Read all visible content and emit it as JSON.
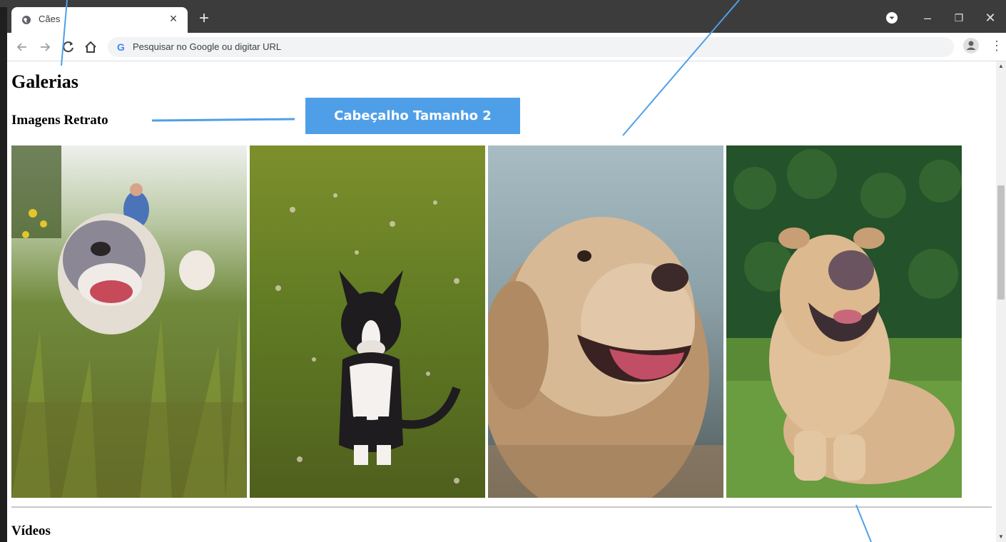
{
  "browser": {
    "tab_title": "Cães",
    "tab_close": "×",
    "new_tab": "+",
    "omnibox_placeholder": "Pesquisar no Google ou digitar URL",
    "google_letter": "G",
    "minimize": "–",
    "restore": "❐",
    "close": "✕",
    "menu": "⋮",
    "icons": [
      "globe-icon",
      "back-icon",
      "forward-icon",
      "reload-icon",
      "home-icon",
      "profile-icon",
      "menu-icon"
    ]
  },
  "page": {
    "h1": "Galerias",
    "h2": "Imagens Retrato",
    "h3": "Vídeos",
    "images": [
      {
        "subject": "staffordshire terrier in tall grass"
      },
      {
        "subject": "boston terrier sitting on lawn"
      },
      {
        "subject": "golden retriever close-up"
      },
      {
        "subject": "shar pei lying on grass"
      }
    ]
  },
  "annotations": {
    "callout": "Cabeçalho Tamanho 2",
    "color": "#4f9fe8"
  }
}
